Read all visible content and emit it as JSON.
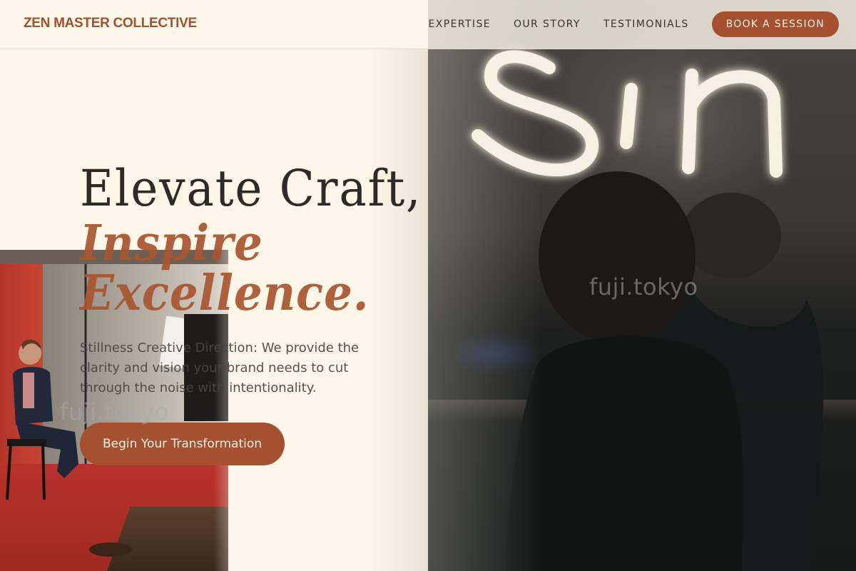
{
  "header": {
    "brand": "ZEN MASTER COLLECTIVE",
    "nav": [
      {
        "label": "EXPERTISE"
      },
      {
        "label": "OUR STORY"
      },
      {
        "label": "TESTIMONIALS"
      }
    ],
    "cta_label": "BOOK A SESSION"
  },
  "hero": {
    "headline_line1": "Elevate Craft,",
    "headline_line2": "Inspire",
    "headline_line3": "Excellence.",
    "subtext": "Stillness Creative Direction: We provide the clarity and vision your brand needs to cut through the noise with intentionality.",
    "cta_label": "Begin Your Transformation"
  },
  "images": {
    "right_photo_neon_text": "Sin",
    "watermark_right": "fuji.tokyo",
    "watermark_left": "fuji.tokyo"
  },
  "colors": {
    "accent": "#a5512f",
    "brand": "#a0512e",
    "background": "#fdf6e9",
    "text_dark": "#2e2a27"
  }
}
